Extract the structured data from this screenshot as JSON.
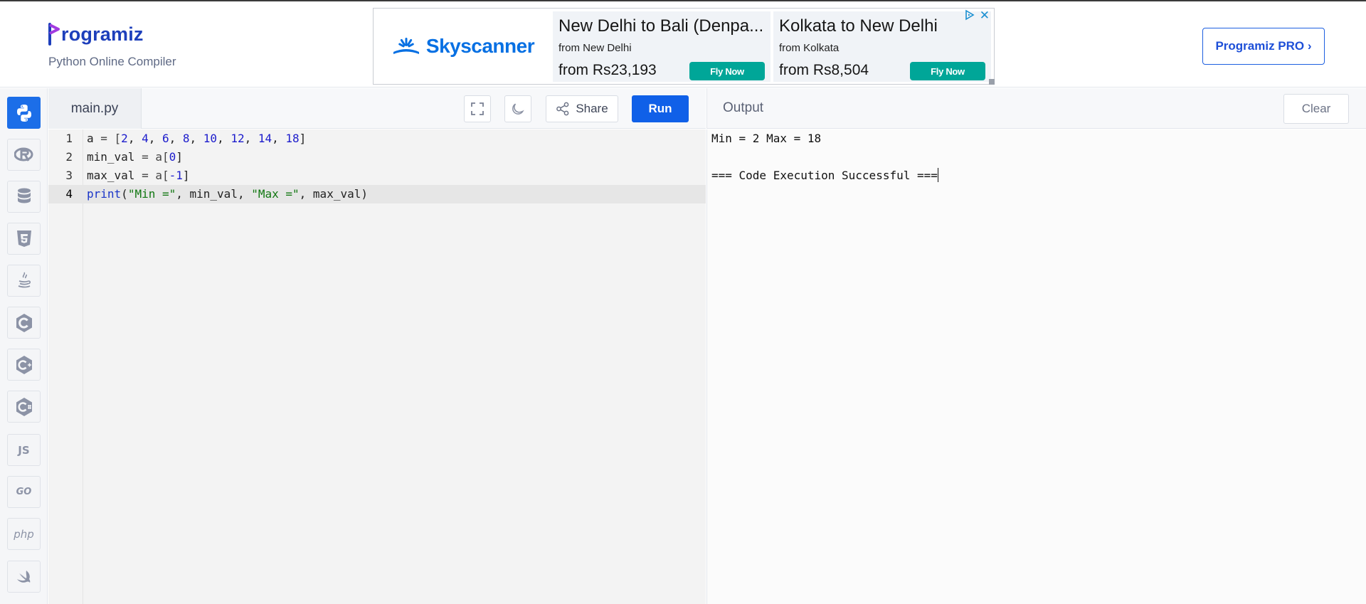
{
  "header": {
    "brand": "rogramiz",
    "tagline": "Python Online Compiler",
    "pro_button": "Programiz PRO ›"
  },
  "ad": {
    "brand": "Skyscanner",
    "cards": [
      {
        "title": "New Delhi to Bali (Denpa...",
        "from": "from New Delhi",
        "price": "from Rs23,193",
        "cta": "Fly Now"
      },
      {
        "title": "Kolkata to New Delhi",
        "from": "from Kolkata",
        "price": "from Rs8,504",
        "cta": "Fly Now"
      }
    ],
    "close": "✕"
  },
  "rail": {
    "items": [
      {
        "name": "python-icon",
        "active": true
      },
      {
        "name": "r-icon"
      },
      {
        "name": "sql-database-icon"
      },
      {
        "name": "html5-icon"
      },
      {
        "name": "java-icon"
      },
      {
        "name": "c-icon"
      },
      {
        "name": "cplusplus-icon"
      },
      {
        "name": "csharp-icon"
      },
      {
        "name": "js-icon",
        "label": "JS"
      },
      {
        "name": "go-icon",
        "label": "GO"
      },
      {
        "name": "php-icon",
        "label": "php"
      },
      {
        "name": "swift-icon"
      }
    ]
  },
  "editor": {
    "file_tab": "main.py",
    "share_label": "Share",
    "run_label": "Run",
    "lines": [
      {
        "n": "1"
      },
      {
        "n": "2"
      },
      {
        "n": "3"
      },
      {
        "n": "4"
      }
    ],
    "code": {
      "l1": {
        "a": "a",
        "eq": " = [",
        "v": [
          "2",
          "4",
          "6",
          "8",
          "10",
          "12",
          "14",
          "18"
        ],
        "close": "]"
      },
      "l2": {
        "name": "min_val",
        "eq": " = a[",
        "idx": "0",
        "close": "]"
      },
      "l3": {
        "name": "max_val",
        "eq": " = a[",
        "idx": "-1",
        "close": "]"
      },
      "l4": {
        "fn": "print",
        "s1": "\"Min =\"",
        "a1": "min_val",
        "s2": "\"Max =\"",
        "a2": "max_val"
      }
    }
  },
  "output": {
    "title": "Output",
    "clear_label": "Clear",
    "lines": [
      "Min = 2 Max = 18",
      "",
      "=== Code Execution Successful ==="
    ]
  }
}
